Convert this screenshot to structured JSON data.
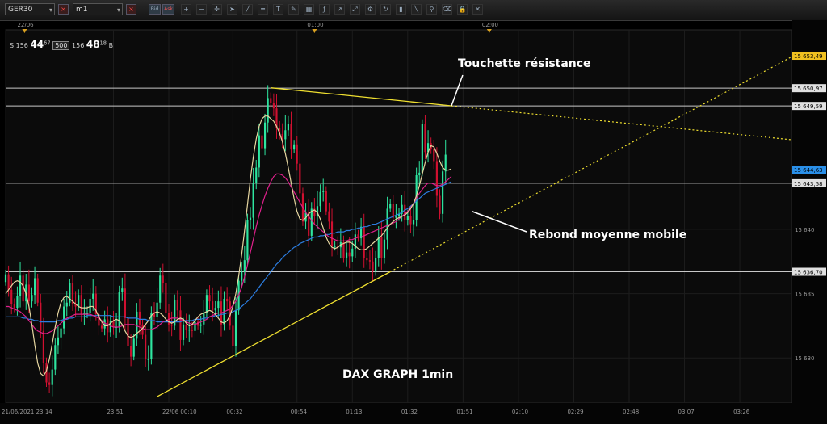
{
  "toolbar": {
    "symbol": "GER30",
    "timeframe": "m1",
    "bid_label": "Bid",
    "ask_label": "Ask",
    "icons": [
      "zoom-in-icon",
      "zoom-out-icon",
      "crosshair-icon",
      "cursor-icon",
      "line-icon",
      "hline-icon",
      "text-icon",
      "pen-icon",
      "template-icon",
      "indicator-icon",
      "arrow-icon",
      "expand-icon",
      "settings-icon",
      "refresh-icon",
      "bar-icon",
      "trend-icon",
      "magnet-icon",
      "eraser-icon",
      "lock-icon",
      "close-icon"
    ]
  },
  "quote": {
    "sell_label": "S",
    "sell_prefix": "156",
    "sell_big": "44",
    "sell_sup": "67",
    "volume": "500",
    "buy_prefix": "156",
    "buy_big": "48",
    "buy_sup": "18",
    "buy_label": "B"
  },
  "colors": {
    "bull": "#2ee6a0",
    "bear": "#d01030",
    "ma_fast": "#e6d6a0",
    "ma_mid": "#e0208c",
    "ma_slow": "#2c7de0",
    "trendline": "#f0e030",
    "level": "#c8c8c8",
    "annotation": "#ffffff"
  },
  "chart_data": {
    "type": "candlestick",
    "instrument": "GER30",
    "timeframe": "m1",
    "title": "DAX GRAPH 1min",
    "date_labels": [
      {
        "label": "22/06",
        "t": 6.5
      },
      {
        "label": "01:00",
        "t": 106
      },
      {
        "label": "02:00",
        "t": 166
      }
    ],
    "time_ticks": [
      {
        "label": "21/06/2021 23:14",
        "t": 0
      },
      {
        "label": "23:51",
        "t": 37
      },
      {
        "label": "22/06 00:10",
        "t": 56
      },
      {
        "label": "00:32",
        "t": 78
      },
      {
        "label": "00:54",
        "t": 100
      },
      {
        "label": "01:13",
        "t": 119
      },
      {
        "label": "01:32",
        "t": 138
      },
      {
        "label": "01:51",
        "t": 157
      },
      {
        "label": "02:10",
        "t": 176
      },
      {
        "label": "02:29",
        "t": 195
      },
      {
        "label": "02:48",
        "t": 214
      },
      {
        "label": "03:07",
        "t": 233
      },
      {
        "label": "03:26",
        "t": 252
      }
    ],
    "time_range": [
      0,
      270
    ],
    "price_range": [
      15626.5,
      15655.5
    ],
    "price_ticks": [
      {
        "label": "15 640",
        "v": 15640
      },
      {
        "label": "15 635",
        "v": 15635
      },
      {
        "label": "15 630",
        "v": 15630
      }
    ],
    "levels": [
      {
        "label": "15 650,97",
        "v": 15650.97
      },
      {
        "label": "15 649,59",
        "v": 15649.59
      },
      {
        "label": "15 643,58",
        "v": 15643.58
      },
      {
        "label": "15 636,70",
        "v": 15636.7
      }
    ],
    "price_markers": [
      {
        "label": "15 653,49",
        "v": 15653.49,
        "color": "#f0c020"
      },
      {
        "label": "15 644,63",
        "v": 15644.63,
        "color": "#2a8fe8"
      }
    ],
    "closes": [
      15636.5,
      15635.3,
      15634.2,
      15633.9,
      15634.8,
      15636.4,
      15634.4,
      15635.7,
      15634.4,
      15634.9,
      15636.2,
      15634.3,
      15632.1,
      15629.6,
      15628.1,
      15627.9,
      15629.1,
      15631.0,
      15631.6,
      15632.3,
      15634.0,
      15634.3,
      15635.8,
      15634.2,
      15634.0,
      15634.9,
      15633.4,
      15633.5,
      15633.5,
      15634.6,
      15635.0,
      15633.4,
      15632.5,
      15632.3,
      15633.0,
      15632.0,
      15632.9,
      15632.4,
      15632.4,
      15635.1,
      15635.4,
      15633.1,
      15630.9,
      15630.1,
      15631.5,
      15633.6,
      15632.6,
      15631.8,
      15629.9,
      15629.9,
      15633.5,
      15633.2,
      15634.3,
      15636.4,
      15635.8,
      15633.5,
      15632.6,
      15632.5,
      15634.5,
      15633.7,
      15631.4,
      15632.6,
      15632.2,
      15632.2,
      15632.1,
      15632.8,
      15632.5,
      15632.6,
      15633.5,
      15634.9,
      15634.4,
      15633.7,
      15633.9,
      15634.4,
      15632.6,
      15634.6,
      15634.4,
      15632.5,
      15630.9,
      15633.7,
      15636.0,
      15636.7,
      15637.6,
      15640.7,
      15640.9,
      15643.6,
      15644.8,
      15647.3,
      15646.3,
      15648.3,
      15650.2,
      15649.8,
      15649.4,
      15647.9,
      15647.4,
      15647.0,
      15647.7,
      15648.2,
      15646.2,
      15646.6,
      15645.1,
      15642.8,
      15640.6,
      15641.3,
      15639.5,
      15641.6,
      15641.0,
      15641.8,
      15642.9,
      15643.0,
      15641.4,
      15640.6,
      15638.7,
      15638.7,
      15638.6,
      15639.0,
      15637.8,
      15638.2,
      15637.9,
      15638.5,
      15639.6,
      15639.3,
      15640.2,
      15637.8,
      15637.6,
      15637.5,
      15636.8,
      15637.8,
      15639.4,
      15637.8,
      15639.2,
      15641.6,
      15642.0,
      15640.9,
      15641.0,
      15641.2,
      15641.9,
      15640.7,
      15641.0,
      15640.4,
      15640.7,
      15644.2,
      15644.4,
      15648.2,
      15646.0,
      15646.7,
      15646.2,
      15645.3,
      15642.6,
      15641.2,
      15644.5,
      15645.8
    ],
    "ma_fast": [
      15635.0,
      15635.3,
      15635.6,
      15635.9,
      15636.0,
      15635.9,
      15635.6,
      15635.0,
      15634.0,
      15632.6,
      15631.0,
      15629.6,
      15628.8,
      15628.6,
      15629.0,
      15629.9,
      15631.1,
      15632.4,
      15633.5,
      15634.3,
      15634.7,
      15634.8,
      15634.6,
      15634.4,
      15634.2,
      15634.0,
      15633.9,
      15633.9,
      15633.9,
      15634.0,
      15634.0,
      15633.7,
      15633.2,
      15632.8,
      15632.5,
      15632.5,
      15632.7,
      15632.9,
      15633.0,
      15632.9,
      15632.6,
      15632.1,
      15631.7,
      15631.6,
      15631.7,
      15631.9,
      15632.1,
      15632.3,
      15632.6,
      15632.9,
      15633.3,
      15633.5,
      15633.6,
      15633.5,
      15633.3,
      15633.0,
      15632.8,
      15632.7,
      15632.8,
      15633.0,
      15633.1,
      15633.0,
      15632.7,
      15632.5,
      15632.6,
      15632.9,
      15633.2,
      15633.4,
      15633.5,
      15633.6,
      15633.7,
      15633.6,
      15633.4,
      15633.1,
      15632.8,
      15632.7,
      15632.9,
      15633.3,
      15634.0,
      15635.0,
      15636.4,
      15638.0,
      15639.9,
      15641.9,
      15643.9,
      15645.6,
      15647.0,
      15648.0,
      15648.6,
      15648.8,
      15648.8,
      15648.6,
      15648.4,
      15648.0,
      15647.5,
      15646.8,
      15645.9,
      15644.8,
      15643.6,
      15642.4,
      15641.4,
      15640.8,
      15640.7,
      15640.9,
      15641.2,
      15641.4,
      15641.5,
      15641.3,
      15640.8,
      15640.1,
      15639.4,
      15638.9,
      15638.6,
      15638.5,
      15638.6,
      15638.8,
      15638.9,
      15639.0,
      15639.0,
      15638.9,
      15638.7,
      15638.5,
      15638.4,
      15638.4,
      15638.5,
      15638.7,
      15638.9,
      15639.1,
      15639.3,
      15639.5,
      15639.8,
      15640.1,
      15640.4,
      15640.6,
      15640.8,
      15640.9,
      15641.0,
      15641.1,
      15641.3,
      15641.6,
      15642.0,
      15642.6,
      15643.4,
      15644.3,
      15645.2,
      15646.0,
      15646.5,
      15646.4,
      15645.9,
      15645.3,
      15644.8,
      15644.6,
      15644.6,
      15644.7
    ],
    "ma_mid": [
      15634.0,
      15634.0,
      15633.9,
      15633.8,
      15633.7,
      15633.6,
      15633.4,
      15633.2,
      15632.9,
      15632.6,
      15632.3,
      15632.1,
      15632.0,
      15631.9,
      15631.9,
      15632.0,
      15632.1,
      15632.3,
      15632.5,
      15632.7,
      15632.9,
      15633.1,
      15633.2,
      15633.3,
      15633.4,
      15633.4,
      15633.4,
      15633.4,
      15633.4,
      15633.4,
      15633.3,
      15633.2,
      15633.1,
      15632.9,
      15632.7,
      15632.6,
      15632.5,
      15632.4,
      15632.4,
      15632.4,
      15632.5,
      15632.6,
      15632.6,
      15632.6,
      15632.6,
      15632.5,
      15632.4,
      15632.3,
      15632.2,
      15632.2,
      15632.2,
      15632.3,
      15632.4,
      15632.6,
      15632.8,
      15632.9,
      15633.0,
      15633.1,
      15633.1,
      15633.1,
      15633.0,
      15632.9,
      15632.8,
      15632.7,
      15632.6,
      15632.6,
      15632.7,
      15632.8,
      15632.9,
      15633.0,
      15633.2,
      15633.3,
      15633.4,
      15633.5,
      15633.5,
      15633.6,
      15633.7,
      15633.8,
      15634.1,
      15634.4,
      15634.9,
      15635.5,
      15636.3,
      15637.2,
      15638.2,
      15639.2,
      15640.2,
      15641.1,
      15641.9,
      15642.6,
      15643.2,
      15643.7,
      15644.1,
      15644.3,
      15644.3,
      15644.2,
      15644.0,
      15643.7,
      15643.3,
      15642.9,
      15642.5,
      15642.1,
      15641.7,
      15641.3,
      15641.0,
      15640.7,
      15640.4,
      15640.2,
      15640.0,
      15639.8,
      15639.6,
      15639.4,
      15639.3,
      15639.2,
      15639.1,
      15639.1,
      15639.1,
      15639.1,
      15639.2,
      15639.2,
      15639.3,
      15639.4,
      15639.4,
      15639.5,
      15639.6,
      15639.7,
      15639.8,
      15639.9,
      15640.0,
      15640.1,
      15640.2,
      15640.3,
      15640.4,
      15640.5,
      15640.6,
      15640.8,
      15641.0,
      15641.2,
      15641.4,
      15641.7,
      15642.0,
      15642.4,
      15642.8,
      15643.1,
      15643.4,
      15643.6,
      15643.6,
      15643.5,
      15643.4,
      15643.4,
      15643.5,
      15643.7,
      15643.9,
      15644.1
    ],
    "ma_slow": [
      15633.2,
      15633.2,
      15633.2,
      15633.2,
      15633.2,
      15633.2,
      15633.1,
      15633.1,
      15633.0,
      15633.0,
      15632.9,
      15632.9,
      15632.8,
      15632.8,
      15632.8,
      15632.8,
      15632.8,
      15632.8,
      15632.9,
      15632.9,
      15633.0,
      15633.0,
      15633.1,
      15633.1,
      15633.2,
      15633.2,
      15633.2,
      15633.2,
      15633.3,
      15633.3,
      15633.3,
      15633.3,
      15633.3,
      15633.3,
      15633.3,
      15633.3,
      15633.3,
      15633.2,
      15633.2,
      15633.2,
      15633.2,
      15633.2,
      15633.1,
      15633.1,
      15633.1,
      15633.1,
      15633.0,
      15633.0,
      15633.0,
      15632.9,
      15632.9,
      15632.9,
      15632.8,
      15632.8,
      15632.8,
      15632.8,
      15632.8,
      15632.8,
      15632.8,
      15632.8,
      15632.8,
      15632.9,
      15632.9,
      15632.9,
      15632.9,
      15633.0,
      15633.0,
      15633.0,
      15633.1,
      15633.1,
      15633.2,
      15633.2,
      15633.3,
      15633.3,
      15633.4,
      15633.4,
      15633.5,
      15633.5,
      15633.6,
      15633.7,
      15633.8,
      15634.0,
      15634.2,
      15634.4,
      15634.6,
      15634.9,
      15635.2,
      15635.5,
      15635.8,
      15636.1,
      15636.4,
      15636.7,
      15637.0,
      15637.3,
      15637.5,
      15637.8,
      15638.0,
      15638.2,
      15638.4,
      15638.6,
      15638.7,
      15638.9,
      15639.0,
      15639.1,
      15639.2,
      15639.3,
      15639.4,
      15639.4,
      15639.5,
      15639.5,
      15639.6,
      15639.6,
      15639.7,
      15639.7,
      15639.8,
      15639.8,
      15639.8,
      15639.9,
      15639.9,
      15640.0,
      15640.0,
      15640.1,
      15640.1,
      15640.2,
      15640.2,
      15640.3,
      15640.4,
      15640.4,
      15640.5,
      15640.6,
      15640.7,
      15640.8,
      15640.9,
      15641.0,
      15641.1,
      15641.2,
      15641.3,
      15641.5,
      15641.6,
      15641.8,
      15642.0,
      15642.2,
      15642.4,
      15642.6,
      15642.8,
      15642.9,
      15643.0,
      15643.1,
      15643.2,
      15643.3,
      15643.4,
      15643.5,
      15643.6,
      15643.7
    ],
    "trendlines": [
      {
        "name": "resistance",
        "from": {
          "t": 91,
          "v": 15651.0
        },
        "to": {
          "t": 153,
          "v": 15649.6
        },
        "extend_to_t": 270,
        "style": "solid-then-dotted"
      },
      {
        "name": "support",
        "from": {
          "t": 52,
          "v": 15627.0
        },
        "to": {
          "t": 132,
          "v": 15636.7
        },
        "extend_to_t": 270,
        "style": "solid-then-dotted"
      }
    ],
    "annotations": [
      {
        "text": "Touchette résistance",
        "t": 153,
        "v": 15649.6
      },
      {
        "text": "Rebond moyenne mobile",
        "t": 160,
        "v": 15641.4
      }
    ]
  }
}
